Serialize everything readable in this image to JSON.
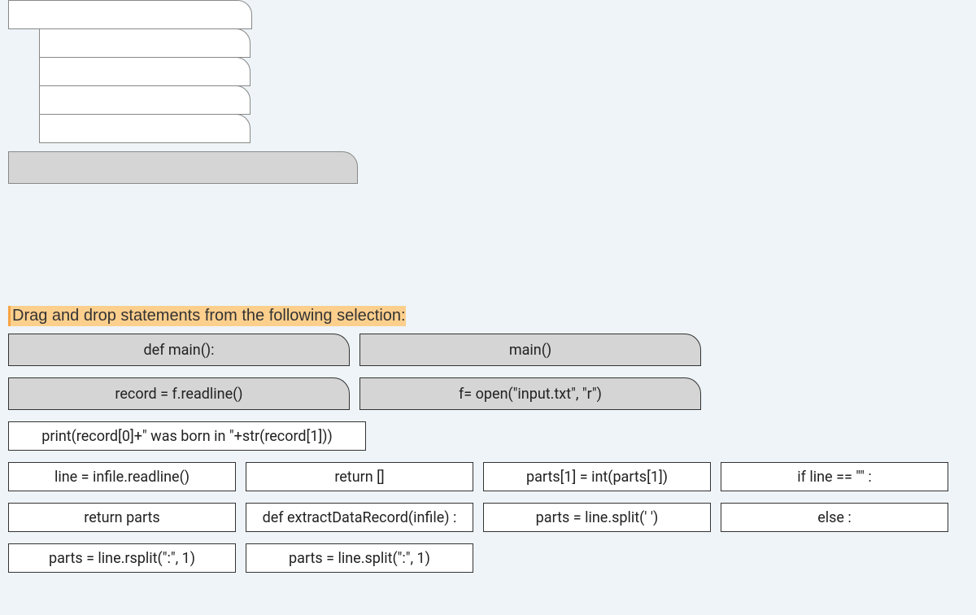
{
  "instruction": "Drag and drop statements from the following selection:",
  "options": {
    "r1": {
      "a": "def main():",
      "b": "main()"
    },
    "r2": {
      "a": "record  = f.readline()",
      "b": "f= open(\"input.txt\", \"r\")"
    },
    "r3": {
      "a": "print(record[0]+\" was born in \"+str(record[1]))"
    },
    "r4": {
      "a": "line = infile.readline()",
      "b": "return []",
      "c": "parts[1] = int(parts[1])",
      "d": "if line == \"\" :"
    },
    "r5": {
      "a": "return parts",
      "b": "def extractDataRecord(infile) :",
      "c": "parts = line.split(' ')",
      "d": "else :"
    },
    "r6": {
      "a": "parts = line.rsplit(\":\", 1)",
      "b": "parts = line.split(\":\", 1)"
    }
  }
}
